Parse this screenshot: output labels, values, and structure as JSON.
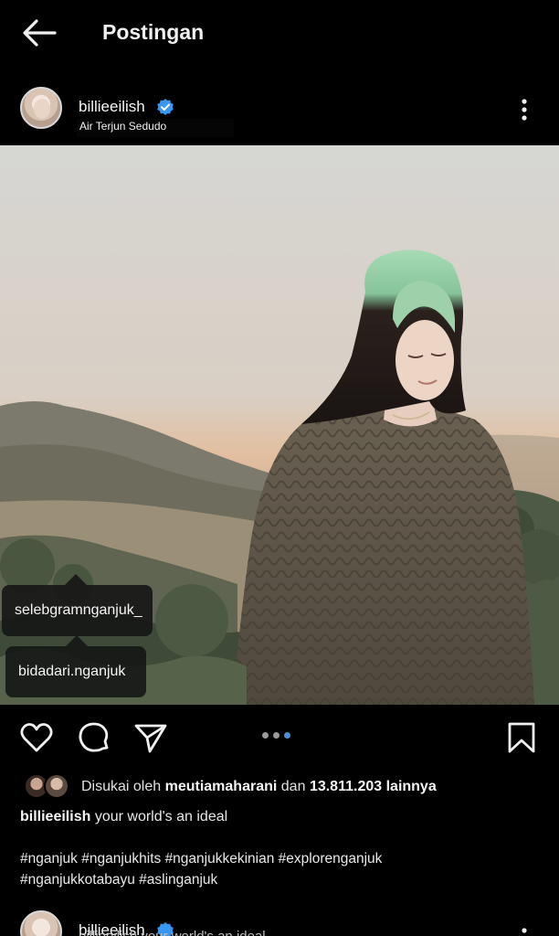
{
  "topbar": {
    "title": "Postingan",
    "back_icon": "arrow-left-icon"
  },
  "post": {
    "username": "billieeilish",
    "verified": true,
    "location": "Air Terjun Sedudo",
    "tags": [
      "selebgramnganjuk_",
      "bidadari.nganjuk"
    ],
    "carousel": {
      "total": 3,
      "active_index": 3
    },
    "likes": {
      "prefix": "Disukai oleh",
      "user": "meutiamaharani",
      "connector": "dan",
      "count": "13.811.203",
      "suffix": "lainnya"
    },
    "caption_user": "billieeilish",
    "caption_text": "your world's an ideal",
    "hashtags_line1": "#nganjuk #nganjukhits #nganjukkekinian #explorenganjuk",
    "hashtags_line2": "#nganjukkotabayu #aslinganjuk"
  },
  "next_post": {
    "username": "billieeilish",
    "caption_text": "billieeilish your world's an ideal"
  },
  "colors": {
    "background": "#000000",
    "verified": "#3897f0",
    "dot_active": "#4d8fd6"
  }
}
